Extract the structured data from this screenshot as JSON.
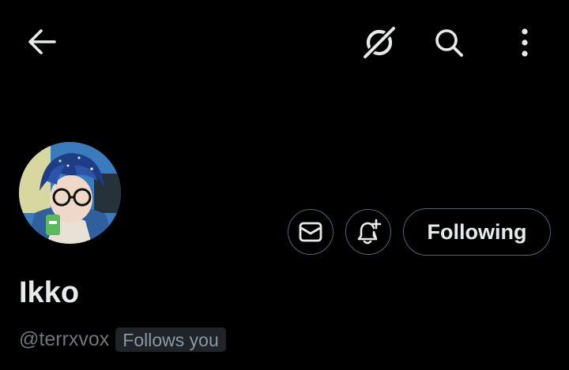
{
  "header": {
    "back_icon": "arrow-left-icon",
    "grok_icon": "grok-icon",
    "search_icon": "search-icon",
    "more_icon": "more-vertical-icon"
  },
  "profile": {
    "avatar_alt": "avatar",
    "display_name": "Ikko",
    "handle": "@terrxvox",
    "follows_you_label": "Follows you"
  },
  "actions": {
    "message_icon": "envelope-icon",
    "notify_icon": "bell-plus-icon",
    "following_label": "Following"
  },
  "colors": {
    "background": "#000000",
    "text_primary": "#e7e9ea",
    "text_secondary": "#71767b",
    "border": "#536471",
    "badge_bg": "#202327"
  }
}
